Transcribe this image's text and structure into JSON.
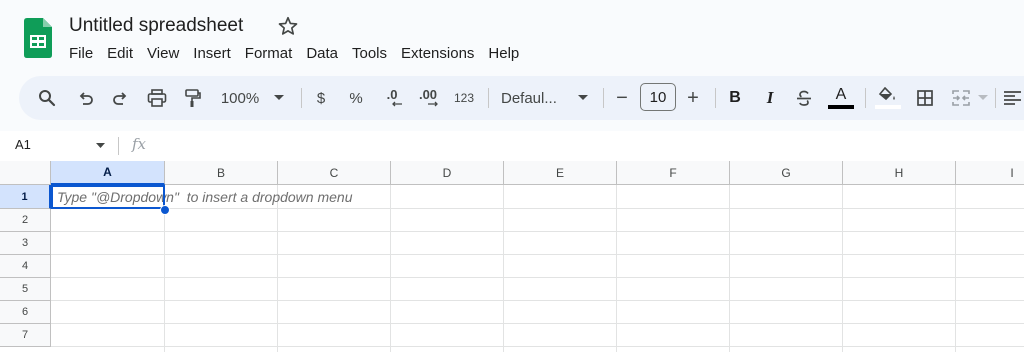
{
  "doc": {
    "title": "Untitled spreadsheet"
  },
  "menu": [
    "File",
    "Edit",
    "View",
    "Insert",
    "Format",
    "Data",
    "Tools",
    "Extensions",
    "Help"
  ],
  "toolbar": {
    "zoom": "100%",
    "currency": "$",
    "percent": "%",
    "decrease_decimal": ".0",
    "increase_decimal": ".00",
    "number_format": "123",
    "font": "Defaul...",
    "font_size": "10",
    "minus": "−",
    "plus": "+",
    "bold": "B",
    "italic": "I",
    "text_color_letter": "A",
    "icons": [
      "search-icon",
      "undo-icon",
      "redo-icon",
      "print-icon",
      "paint-format-icon",
      "zoom-dropdown-icon",
      "font-dropdown-icon",
      "strikethrough-icon",
      "fill-color-icon",
      "borders-icon",
      "merge-cells-icon",
      "align-icon"
    ]
  },
  "formula_bar": {
    "name_box": "A1",
    "fx": "fx"
  },
  "grid": {
    "columns": [
      "A",
      "B",
      "C",
      "D",
      "E",
      "F",
      "G",
      "H",
      "I"
    ],
    "rows": [
      "1",
      "2",
      "3",
      "4",
      "5",
      "6",
      "7"
    ],
    "selected_cell": "A1",
    "hint": "Type \"@Dropdown\"  to insert a dropdown menu"
  },
  "colors": {
    "accent": "#0b57d0",
    "toolbar_bg": "#edf2fa",
    "logo": "#0f9d58"
  }
}
